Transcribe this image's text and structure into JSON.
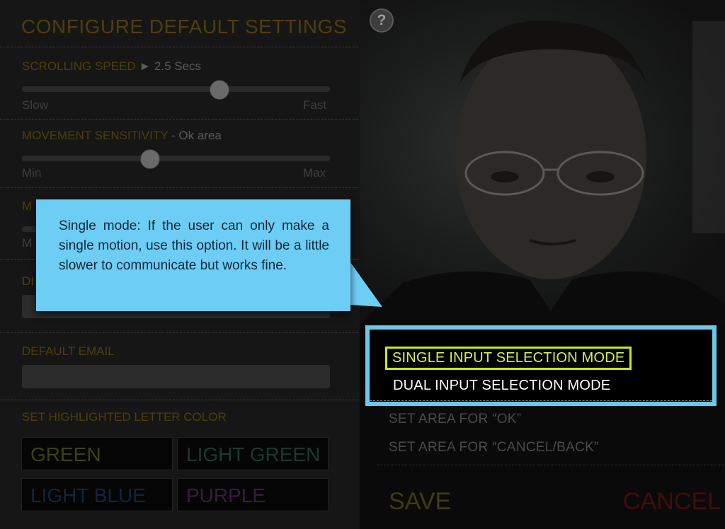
{
  "settings": {
    "title": "CONFIGURE DEFAULT SETTINGS",
    "scrolling_speed": {
      "label": "SCROLLING SPEED",
      "value": "► 2.5 Secs",
      "min_label": "Slow",
      "max_label": "Fast",
      "level": 0.65
    },
    "movement_sensitivity": {
      "label": "MOVEMENT SENSITIVITY",
      "value": "- Ok area",
      "min_label": "Min",
      "max_label": "Max",
      "level": 0.41
    },
    "third_row": {
      "label_fragment": "M",
      "min_fragment": "M"
    },
    "fourth_row": {
      "label_fragment": "DI"
    },
    "default_email": {
      "label": "DEFAULT EMAIL",
      "value": ""
    },
    "highlight_color": {
      "label": "SET HIGHLIGHTED LETTER COLOR",
      "options": [
        {
          "label": "GREEN",
          "color": "#3d4212"
        },
        {
          "label": "LIGHT GREEN",
          "color": "#183a2e"
        },
        {
          "label": "LIGHT BLUE",
          "color": "#14233c"
        },
        {
          "label": "PURPLE",
          "color": "#3a1a42"
        }
      ]
    }
  },
  "camera": {
    "help_icon": "question-icon",
    "help_label": "?"
  },
  "modes": {
    "items": [
      {
        "label": "SINGLE INPUT SELECTION MODE",
        "selected": true
      },
      {
        "label": "DUAL INPUT SELECTION MODE",
        "selected": false
      }
    ]
  },
  "areas": {
    "ok": "SET AREA FOR “OK”",
    "cancel_back": "SET AREA FOR “CANCEL/BACK”"
  },
  "actions": {
    "save": "SAVE",
    "cancel": "CANCEL"
  },
  "tooltip": {
    "text": "Single mode:  If the user can only make a single motion, use this option. It will be a little slower to communicate but works fine."
  },
  "colors": {
    "accent_highlight": "#c4ec1c",
    "mode_border": "#6bc8ea",
    "tooltip_bg": "#6dcdf5"
  }
}
